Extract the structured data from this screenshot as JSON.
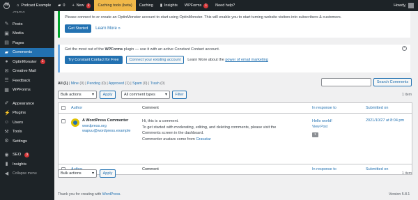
{
  "adminbar": {
    "site_name": "Podcast Example",
    "comments_count": "0",
    "new_label": "New",
    "new_badge": "2",
    "highlight_label": "Caching tools (beta)",
    "caching_label": "Caching",
    "insights_label": "Insights",
    "wpforms_label": "WPForms",
    "wpforms_badge": "1",
    "help_label": "Need help?",
    "user_label": "Howdy,"
  },
  "sidebar": {
    "top_item": "Jetpack",
    "items": [
      {
        "label": "Posts",
        "icon": "pin-icon"
      },
      {
        "label": "Media",
        "icon": "media-icon"
      },
      {
        "label": "Pages",
        "icon": "page-icon"
      },
      {
        "label": "Comments",
        "icon": "comment-icon",
        "active": true
      },
      {
        "label": "OptinMonster",
        "icon": "optinmonster-icon",
        "badge": "1"
      },
      {
        "label": "Creative Mail",
        "icon": "mail-icon"
      },
      {
        "label": "Feedback",
        "icon": "feedback-icon"
      },
      {
        "label": "WPForms",
        "icon": "wpforms-icon"
      },
      {
        "label": "Appearance",
        "icon": "brush-icon"
      },
      {
        "label": "Plugins",
        "icon": "plugin-icon"
      },
      {
        "label": "Users",
        "icon": "users-icon"
      },
      {
        "label": "Tools",
        "icon": "wrench-icon"
      },
      {
        "label": "Settings",
        "icon": "settings-icon"
      },
      {
        "label": "SEO",
        "icon": "seo-icon",
        "badge": "3"
      },
      {
        "label": "Insights",
        "icon": "insights-icon"
      },
      {
        "label": "Collapse menu",
        "icon": "collapse-icon"
      }
    ]
  },
  "notice_optinmonster": {
    "text": "Please connect to or create an OptinMonster account to start using OptinMonster. This will enable you to start turning website visitors into subscribers & customers.",
    "button": "Get Started",
    "link": "Learn More »"
  },
  "notice_wpforms": {
    "text_prefix": "Get the most out of the ",
    "text_bold": "WPForms",
    "text_suffix": " plugin — use it with an active Constant Contact account.",
    "button_primary": "Try Constant Contact for Free",
    "button_secondary": "Connect your existing account",
    "learn_prefix": "Learn More about the ",
    "learn_link": "power of email marketing"
  },
  "filters": {
    "all": "All",
    "all_count": "(1)",
    "mine": "Mine",
    "mine_count": "(0)",
    "pending": "Pending",
    "pending_count": "(0)",
    "approved": "Approved",
    "approved_count": "(1)",
    "spam": "Spam",
    "spam_count": "(0)",
    "trash": "Trash",
    "trash_count": "(0)",
    "separator": "|"
  },
  "search_button": "Search Comments",
  "bulk_actions": "Bulk actions",
  "apply": "Apply",
  "comment_types": "All comment types",
  "filter": "Filter",
  "item_count": "1 item",
  "table": {
    "headers": {
      "author": "Author",
      "comment": "Comment",
      "response": "In response to",
      "submitted": "Submitted on"
    },
    "row": {
      "author_name": "A WordPress Commenter",
      "author_url": "wordpress.org",
      "author_email": "wapuu@wordpress.example",
      "comment_lines": [
        "Hi, this is a comment.",
        "To get started with moderating, editing, and deleting comments, please visit the",
        "Comments screen in the dashboard."
      ],
      "avatar_prefix": "Commenter avatars come from ",
      "avatar_link": "Gravatar",
      "response_title": "Hello world!",
      "response_view": "View Post",
      "response_count": "1",
      "submitted": "2021/10/27 at 8:04 pm"
    }
  },
  "footer": {
    "thanks_prefix": "Thank you for creating with ",
    "thanks_link": "WordPress",
    "version": "Version 5.8.1"
  }
}
